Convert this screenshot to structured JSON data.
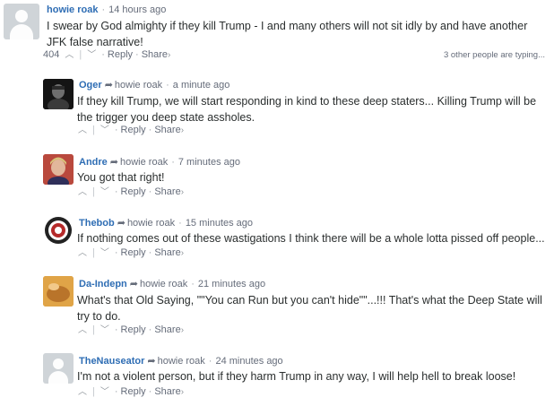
{
  "root": {
    "author": "howie roak",
    "time": "14 hours ago",
    "text": "I swear by God almighty if they kill Trump - I and many others will not sit idly by and have another JFK false narrative!",
    "votes": "404",
    "reply_label": "Reply",
    "share_label": "Share",
    "typing": "3 other people are typing..."
  },
  "replies": [
    {
      "author": "Oger",
      "reply_to": "howie roak",
      "time": "a minute ago",
      "text": "If they kill Trump, we will start responding in kind to these deep staters... Killing Trump will be the trigger you deep state assholes.",
      "avatar": "photo-dark",
      "reply_label": "Reply",
      "share_label": "Share"
    },
    {
      "author": "Andre",
      "reply_to": "howie roak",
      "time": "7 minutes ago",
      "text": "You got that right!",
      "avatar": "photo-face",
      "reply_label": "Reply",
      "share_label": "Share"
    },
    {
      "author": "Thebob",
      "reply_to": "howie roak",
      "time": "15 minutes ago",
      "text": "If nothing comes out of these wastigations I think there will be a whole lotta pissed off people...",
      "avatar": "seal-badge",
      "reply_label": "Reply",
      "share_label": "Share"
    },
    {
      "author": "Da-Indepn",
      "reply_to": "howie roak",
      "time": "21 minutes ago",
      "text": "What's that Old Saying, \"\"You can Run but you can't hide\"\"...!!! That's what the Deep State will try to do.",
      "avatar": "photo-warm",
      "reply_label": "Reply",
      "share_label": "Share"
    },
    {
      "author": "TheNauseator",
      "reply_to": "howie roak",
      "time": "24 minutes ago",
      "text": "I'm not a violent person, but if they harm Trump in any way, I will help hell to break loose!",
      "avatar": "generic",
      "reply_label": "Reply",
      "share_label": "Share"
    }
  ],
  "icons": {
    "upvote": "chevron-up-icon",
    "downvote": "chevron-down-icon",
    "share_chevron": "chevron-right-icon",
    "reply_arrow": "reply-arrow-icon"
  },
  "colors": {
    "author_link": "#2e6db4",
    "meta_text": "#656c7a",
    "body_text": "#2a2e2e"
  }
}
